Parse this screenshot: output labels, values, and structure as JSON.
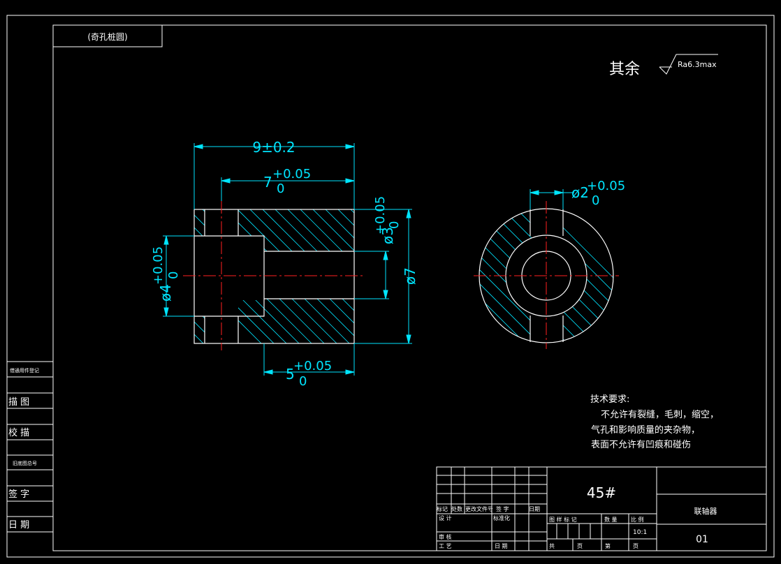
{
  "colors": {
    "outline": "#ffffff",
    "dimension": "#00e5ff",
    "centerline": "#ff2020",
    "hatch": "#00e5ff",
    "background": "#000000"
  },
  "corner_label": "(奇孔桩圆)",
  "roughness": {
    "prefix": "其余",
    "value": "Ra6.3max"
  },
  "dimensions": {
    "overall_length": "9±0.2",
    "bore_depth": "7",
    "bore_depth_tol_upper": "+0.05",
    "bore_depth_tol_lower": "0",
    "step_length": "5",
    "step_length_tol_upper": "+0.05",
    "step_length_tol_lower": "0",
    "diam_small": "ø3",
    "diam_small_tol_upper": "+0.05",
    "diam_small_tol_lower": "0",
    "diam_outer": "ø7",
    "diam_left": "ø4",
    "diam_left_tol_upper": "+0.05",
    "diam_left_tol_lower": "0",
    "hole_diam": "ø2",
    "hole_diam_tol_upper": "+0.05",
    "hole_diam_tol_lower": "0"
  },
  "tech_requirements": {
    "title": "技术要求:",
    "lines": [
      "不允许有裂缝，毛刺，缩空，",
      "气孔和影响质量的夹杂物，",
      "表面不允许有凹痕和碰伤"
    ]
  },
  "side_column": [
    "借通用件登记",
    "描  图",
    "校  描",
    "旧底图总号",
    "签  字",
    "日  期"
  ],
  "title_block": {
    "material": "45#",
    "part_name": "联轴器",
    "drawing_no": "01",
    "scale": "10:1",
    "header_row": [
      "标记",
      "处数",
      "更改文件号",
      "签  字",
      "日期"
    ],
    "design": "设  计",
    "standardize": "标准化",
    "review": "审  核",
    "process": "工  艺",
    "date": "日  期",
    "stage_label": "图  样  标  记",
    "weight_label": "数  量",
    "scale_label": "比  例",
    "total": "共",
    "sheet": "页",
    "page_no": "第",
    "page": "页"
  }
}
